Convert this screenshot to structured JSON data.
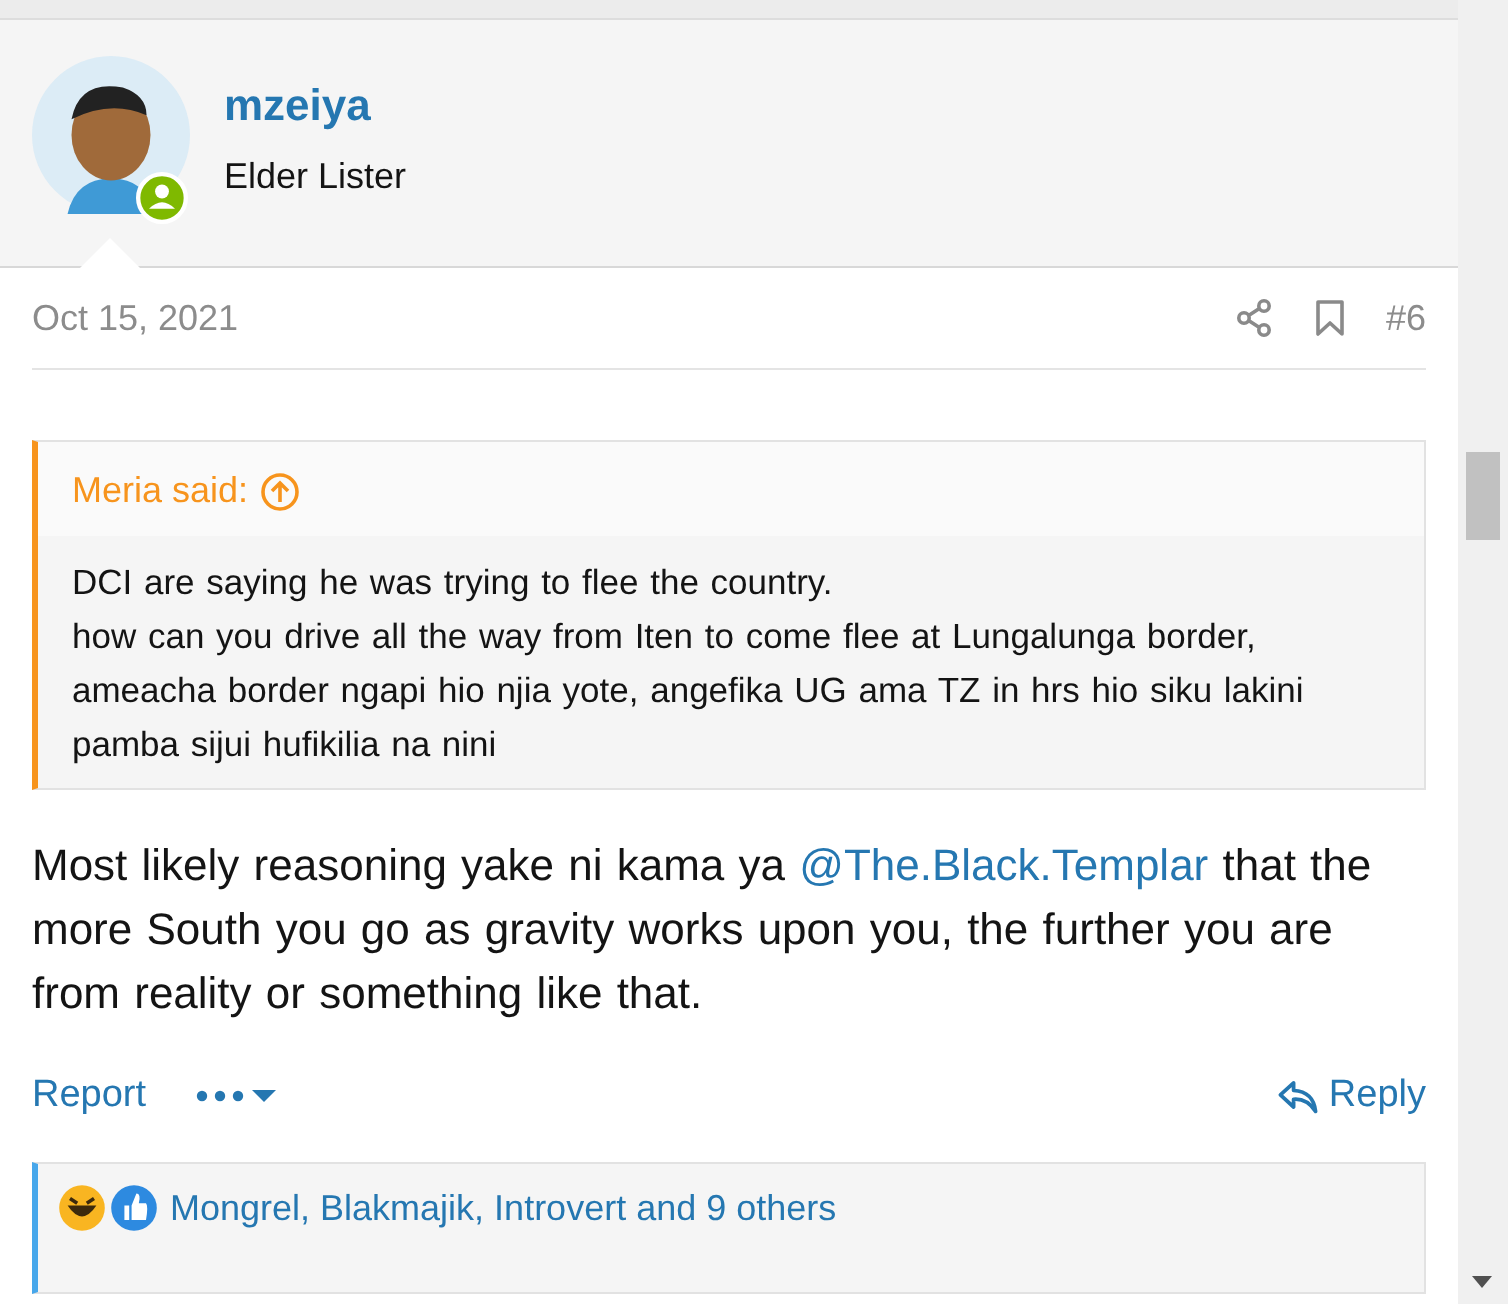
{
  "author": {
    "name": "mzeiya",
    "title": "Elder Lister",
    "online": true
  },
  "post": {
    "date": "Oct 15, 2021",
    "number": "#6",
    "quote": {
      "header": "Meria said:",
      "paragraphs": [
        "DCI are saying he was trying to flee the country.",
        "how can you drive all the way from Iten to come flee at Lungalunga border, ameacha border ngapi hio njia yote, angefika UG ama TZ in hrs hio siku lakini pamba sijui hufikilia na nini"
      ]
    },
    "body": [
      {
        "kind": "text",
        "text": "Most likely reasoning yake ni kama ya "
      },
      {
        "kind": "mention",
        "text": "@The.Black.Templar"
      },
      {
        "kind": "text",
        "text": " that the more South you go as gravity works upon you, the further you are from reality or something like that."
      }
    ],
    "actions": {
      "report": "Report",
      "reply": "Reply"
    },
    "reactions": "Mongrel, Blakmajik, Introvert and 9 others"
  }
}
